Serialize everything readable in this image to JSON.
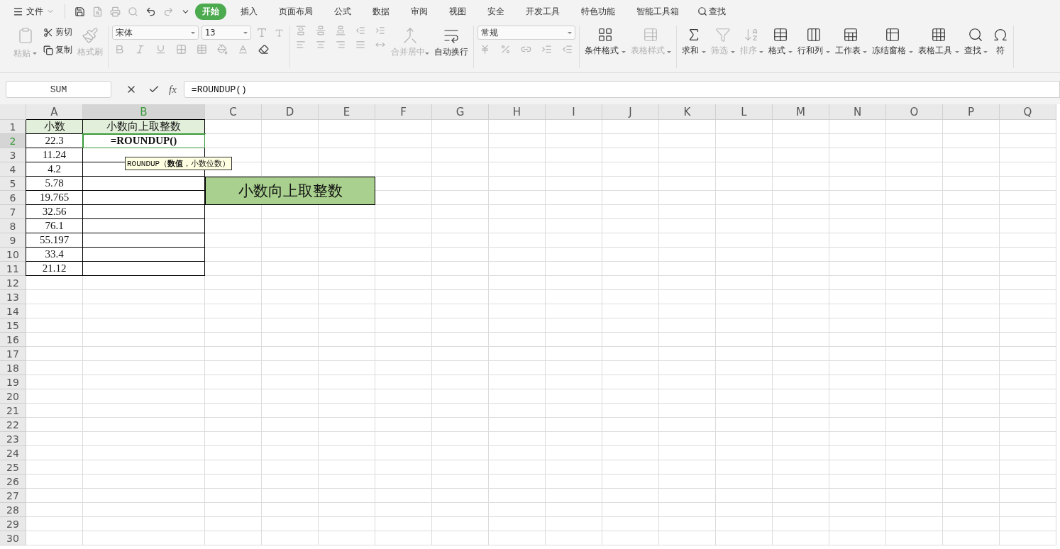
{
  "menu": {
    "file": "文件",
    "tabs": [
      {
        "label": "开始",
        "selected": true
      },
      {
        "label": "插入",
        "selected": false
      },
      {
        "label": "页面布局",
        "selected": false
      },
      {
        "label": "公式",
        "selected": false
      },
      {
        "label": "数据",
        "selected": false
      },
      {
        "label": "审阅",
        "selected": false
      },
      {
        "label": "视图",
        "selected": false
      },
      {
        "label": "安全",
        "selected": false
      },
      {
        "label": "开发工具",
        "selected": false
      },
      {
        "label": "特色功能",
        "selected": false
      },
      {
        "label": "智能工具箱",
        "selected": false
      }
    ],
    "search": "查找"
  },
  "ribbon": {
    "groups": [
      {
        "kind": "clipboard",
        "items": [
          {
            "label": "粘贴",
            "disabled": true,
            "dropdown": true
          },
          {
            "label": "剪切",
            "disabled": false,
            "dropdown": false
          },
          {
            "label": "复制",
            "disabled": false,
            "dropdown": false
          },
          {
            "label": "格式刷",
            "disabled": true,
            "dropdown": false
          }
        ]
      },
      {
        "kind": "font",
        "font": "宋体",
        "size": "13"
      },
      {
        "kind": "align",
        "items": [
          {
            "label": "合并居中",
            "disabled": true,
            "dropdown": true
          },
          {
            "label": "自动换行",
            "disabled": false,
            "dropdown": false
          }
        ]
      },
      {
        "kind": "number",
        "format": "常规"
      },
      {
        "kind": "buttons",
        "items": [
          {
            "label": "条件格式",
            "disabled": false,
            "dropdown": true
          },
          {
            "label": "表格样式",
            "disabled": true,
            "dropdown": true
          }
        ]
      },
      {
        "kind": "buttons",
        "items": [
          {
            "label": "求和",
            "disabled": false,
            "dropdown": true
          },
          {
            "label": "筛选",
            "disabled": true,
            "dropdown": true
          },
          {
            "label": "排序",
            "disabled": true,
            "dropdown": true
          },
          {
            "label": "格式",
            "disabled": false,
            "dropdown": true
          },
          {
            "label": "行和列",
            "disabled": false,
            "dropdown": true
          },
          {
            "label": "工作表",
            "disabled": false,
            "dropdown": true
          },
          {
            "label": "冻结窗格",
            "disabled": false,
            "dropdown": true
          },
          {
            "label": "表格工具",
            "disabled": false,
            "dropdown": true
          },
          {
            "label": "查找",
            "disabled": false,
            "dropdown": true
          },
          {
            "label": "符",
            "disabled": false,
            "dropdown": false
          }
        ]
      }
    ]
  },
  "formula_bar": {
    "name_box": "SUM",
    "fx": "fx",
    "value": "=ROUNDUP()"
  },
  "columns": [
    {
      "label": "A",
      "selected": false
    },
    {
      "label": "B",
      "selected": true
    },
    {
      "label": "C",
      "selected": false
    },
    {
      "label": "D",
      "selected": false
    },
    {
      "label": "E",
      "selected": false
    },
    {
      "label": "F",
      "selected": false
    },
    {
      "label": "G",
      "selected": false
    },
    {
      "label": "H",
      "selected": false
    },
    {
      "label": "I",
      "selected": false
    },
    {
      "label": "J",
      "selected": false
    },
    {
      "label": "K",
      "selected": false
    },
    {
      "label": "L",
      "selected": false
    },
    {
      "label": "M",
      "selected": false
    },
    {
      "label": "N",
      "selected": false
    },
    {
      "label": "O",
      "selected": false
    },
    {
      "label": "P",
      "selected": false
    },
    {
      "label": "Q",
      "selected": false
    }
  ],
  "rows": [
    {
      "label": "1",
      "selected": false,
      "kind": "header",
      "cells": [
        {
          "text": "小数",
          "selected": false
        },
        {
          "text": "小数向上取整数",
          "selected": false
        }
      ]
    },
    {
      "label": "2",
      "selected": true,
      "kind": "data",
      "cells": [
        {
          "text": "22.3",
          "selected": false
        },
        {
          "text": "=ROUNDUP()",
          "selected": true
        }
      ]
    },
    {
      "label": "3",
      "selected": false,
      "kind": "data",
      "cells": [
        {
          "text": "11.24",
          "selected": false
        },
        {
          "text": "",
          "selected": false
        }
      ]
    },
    {
      "label": "4",
      "selected": false,
      "kind": "data",
      "cells": [
        {
          "text": "4.2",
          "selected": false
        },
        {
          "text": "",
          "selected": false
        }
      ]
    },
    {
      "label": "5",
      "selected": false,
      "kind": "data",
      "cells": [
        {
          "text": "5.78",
          "selected": false
        },
        {
          "text": "",
          "selected": false
        }
      ]
    },
    {
      "label": "6",
      "selected": false,
      "kind": "data",
      "cells": [
        {
          "text": "19.765",
          "selected": false
        },
        {
          "text": "",
          "selected": false
        }
      ]
    },
    {
      "label": "7",
      "selected": false,
      "kind": "data",
      "cells": [
        {
          "text": "32.56",
          "selected": false
        },
        {
          "text": "",
          "selected": false
        }
      ]
    },
    {
      "label": "8",
      "selected": false,
      "kind": "data",
      "cells": [
        {
          "text": "76.1",
          "selected": false
        },
        {
          "text": "",
          "selected": false
        }
      ]
    },
    {
      "label": "9",
      "selected": false,
      "kind": "data",
      "cells": [
        {
          "text": "55.197",
          "selected": false
        },
        {
          "text": "",
          "selected": false
        }
      ]
    },
    {
      "label": "10",
      "selected": false,
      "kind": "data",
      "cells": [
        {
          "text": "33.4",
          "selected": false
        },
        {
          "text": "",
          "selected": false
        }
      ]
    },
    {
      "label": "11",
      "selected": false,
      "kind": "data",
      "cells": [
        {
          "text": "21.12",
          "selected": false
        },
        {
          "text": "",
          "selected": false
        }
      ]
    },
    {
      "label": "12",
      "selected": false
    },
    {
      "label": "13",
      "selected": false
    },
    {
      "label": "14",
      "selected": false
    },
    {
      "label": "15",
      "selected": false
    },
    {
      "label": "16",
      "selected": false
    },
    {
      "label": "17",
      "selected": false
    },
    {
      "label": "18",
      "selected": false
    },
    {
      "label": "19",
      "selected": false
    },
    {
      "label": "20",
      "selected": false
    },
    {
      "label": "21",
      "selected": false
    },
    {
      "label": "22",
      "selected": false
    },
    {
      "label": "23",
      "selected": false
    },
    {
      "label": "24",
      "selected": false
    },
    {
      "label": "25",
      "selected": false
    },
    {
      "label": "26",
      "selected": false
    },
    {
      "label": "27",
      "selected": false
    },
    {
      "label": "28",
      "selected": false
    },
    {
      "label": "29",
      "selected": false
    },
    {
      "label": "30",
      "selected": false
    }
  ],
  "merged_cell": {
    "text": "小数向上取整数"
  },
  "tooltip": {
    "text": "ROUNDUP（**数值**，小数位数）"
  }
}
